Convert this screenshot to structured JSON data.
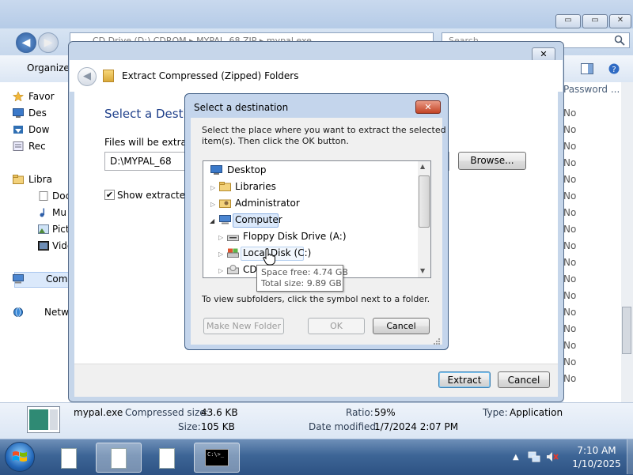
{
  "explorer": {
    "title_buttons": {
      "minimize": "▭",
      "maximize": "▭",
      "close": "✕"
    },
    "address": "CD Drive (D:) CDROM ▸ MYPAL_68.ZIP ▸ mypal.exe",
    "search_placeholder": "Search",
    "organize_label": "Organize",
    "nav_items": [
      "Favor",
      "Des",
      "Dow",
      "Rec",
      "Libra",
      "Doc",
      "Mu",
      "Pict",
      "Vide",
      "Comp",
      "Netw"
    ],
    "column_header": "Password ...",
    "protected_values": [
      "No",
      "No",
      "No",
      "No",
      "No",
      "No",
      "No",
      "No",
      "No",
      "No",
      "No",
      "No",
      "No",
      "No",
      "No",
      "No",
      "No"
    ],
    "details": {
      "file_name": "mypal.exe",
      "compressed_size_label": "Compressed size:",
      "compressed_size": "43.6 KB",
      "size_label": "Size:",
      "size": "105 KB",
      "ratio_label": "Ratio:",
      "ratio": "59%",
      "date_label": "Date modified:",
      "date": "1/7/2024 2:07 PM",
      "type_label": "Type:",
      "type": "Application"
    }
  },
  "wizard": {
    "title": "Extract Compressed (Zipped) Folders",
    "close_glyph": "✕",
    "back_glyph": "◀",
    "heading": "Select a Destination and Extract Files",
    "files_label": "Files will be extracted to this folder:",
    "path_value": "D:\\MYPAL_68",
    "browse_label": "Browse...",
    "show_checkbox_checked": true,
    "show_label": "Show extracted files when complete",
    "extract_label": "Extract",
    "cancel_label": "Cancel"
  },
  "dest_dialog": {
    "title": "Select a destination",
    "close_glyph": "✕",
    "instruction_line1": "Select the place where you want to extract the selected",
    "instruction_line2": "item(s).  Then click the OK button.",
    "tree": {
      "desktop": "Desktop",
      "libraries": "Libraries",
      "administrator": "Administrator",
      "computer": "Computer",
      "floppy": "Floppy Disk Drive (A:)",
      "local_disk": "Local Disk (C:)",
      "cd": "CD"
    },
    "tooltip_free": "Space free: 4.74 GB",
    "tooltip_total": "Total size: 9.89 GB",
    "hint": "To view subfolders, click the symbol next to a folder.",
    "make_folder_label": "Make New Folder",
    "ok_label": "OK",
    "cancel_label": "Cancel"
  },
  "taskbar": {
    "cmd_text": "C:\\>_",
    "tray_arrow": "▲",
    "time": "7:10 AM",
    "date": "1/10/2025"
  },
  "colors": {
    "wizard_heading": "#1e3f8a",
    "title_close_red": "#c34325",
    "selection_blue": "#dbe9fb"
  }
}
